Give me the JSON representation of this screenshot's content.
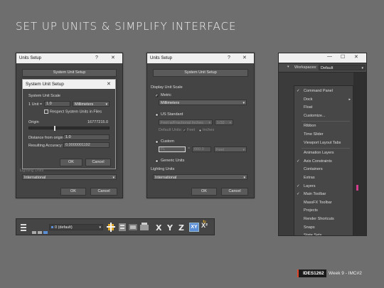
{
  "slide_title": "SET UP UNITS & SIMPLIFY INTERFACE",
  "footer": {
    "brand": "IDES1262",
    "week": "Week 9 - IMC#2"
  },
  "win1": {
    "title": "Units Setup",
    "help": "?",
    "close": "✕",
    "system_unit_setup_btn": "System Unit Setup",
    "lighting_units_label": "Lighting Units",
    "lighting_units_value": "International",
    "ok": "OK",
    "cancel": "Cancel",
    "inner": {
      "title": "System Unit Setup",
      "close": "✕",
      "scale_label": "System Unit Scale",
      "unit_prefix": "1 Unit =",
      "unit_value": "1.0",
      "unit_dropdown": "Millimeters",
      "respect_label": "Respect System Units in Files",
      "origin_label": "Origin",
      "origin_value": "16777215.0",
      "distance_label": "Distance from origin:",
      "distance_value": "1.0",
      "accuracy_label": "Resulting Accuracy:",
      "accuracy_value": "0.0000001192",
      "ok": "OK",
      "cancel": "Cancel"
    }
  },
  "win2": {
    "title": "Units Setup",
    "help": "?",
    "close": "✕",
    "system_unit_setup_btn": "System Unit Setup",
    "display_scale_label": "Display Unit Scale",
    "metric_label": "Metric",
    "metric_value": "Millimeters",
    "us_label": "US Standard",
    "us_value": "Feet w/Fractional Inches",
    "us_fraction": "1/32",
    "default_units_label": "Default Units:",
    "feet_label": "Feet",
    "inches_label": "Inches",
    "custom_label": "Custom",
    "custom_value": "FL",
    "custom_eq": "=",
    "custom_num": "660.0",
    "custom_unit": "Feet",
    "generic_label": "Generic Units",
    "lighting_units_label": "Lighting Units",
    "lighting_units_value": "International",
    "ok": "OK",
    "cancel": "Cancel"
  },
  "toolbar": {
    "layer_dropdown": "0 (default)",
    "x": "X",
    "y": "Y",
    "z": "Z",
    "xy": "XY",
    "xy_sub": "X²"
  },
  "win3": {
    "minimize": "—",
    "maximize": "☐",
    "close": "✕",
    "workspaces_label": "Workspaces:",
    "workspace_value": "Default",
    "menu": [
      {
        "label": "Command Panel",
        "checked": true
      },
      {
        "label": "Dock",
        "checked": false,
        "submenu": true
      },
      {
        "label": "Float",
        "checked": false
      },
      {
        "label": "Customize...",
        "checked": false,
        "sep_after": true
      },
      {
        "label": "Ribbon",
        "checked": false
      },
      {
        "label": "Time Slider",
        "checked": false
      },
      {
        "label": "Viewport Layout Tabs",
        "checked": false,
        "sep_after": true
      },
      {
        "label": "Animation Layers",
        "checked": false
      },
      {
        "label": "Axis Constraints",
        "checked": true
      },
      {
        "label": "Containers",
        "checked": false
      },
      {
        "label": "Extras",
        "checked": false
      },
      {
        "label": "Layers",
        "checked": true
      },
      {
        "label": "Main Toolbar",
        "checked": true
      },
      {
        "label": "MassFX Toolbar",
        "checked": false
      },
      {
        "label": "Projects",
        "checked": false
      },
      {
        "label": "Render Shortcuts",
        "checked": false
      },
      {
        "label": "Snaps",
        "checked": false
      },
      {
        "label": "State Sets",
        "checked": false
      }
    ],
    "check_glyph": "✓",
    "submenu_glyph": "▸"
  }
}
